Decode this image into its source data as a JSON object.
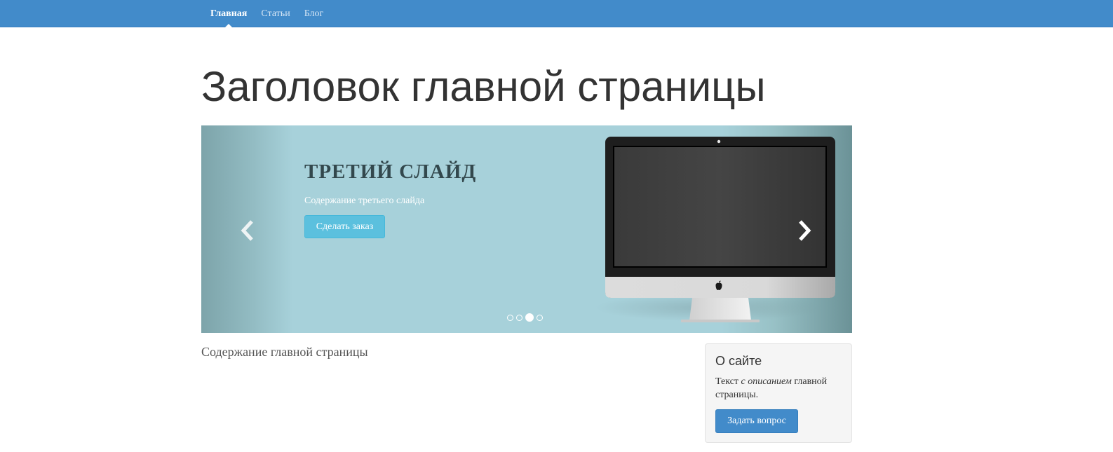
{
  "nav": {
    "items": [
      {
        "label": "Главная",
        "active": true
      },
      {
        "label": "Статьи",
        "active": false
      },
      {
        "label": "Блог",
        "active": false
      }
    ]
  },
  "page": {
    "title": "Заголовок главной страницы",
    "content": "Содержание главной страницы"
  },
  "carousel": {
    "slide_title": "ТРЕТИЙ СЛАЙД",
    "slide_text": "Содержание третьего слайда",
    "button_label": "Сделать заказ",
    "indicator_count": 4,
    "active_indicator": 3
  },
  "sidebar": {
    "title": "О сайте",
    "text_before": "Текст ",
    "text_em": "с описанием",
    "text_after": " главной страницы.",
    "button_label": "Задать вопрос"
  },
  "colors": {
    "navbar": "#428bca",
    "slide_button": "#5bc0de",
    "primary_button": "#428bca"
  },
  "icons": {
    "prev": "chevron-left-icon",
    "next": "chevron-right-icon",
    "brand": "apple-logo-icon"
  }
}
